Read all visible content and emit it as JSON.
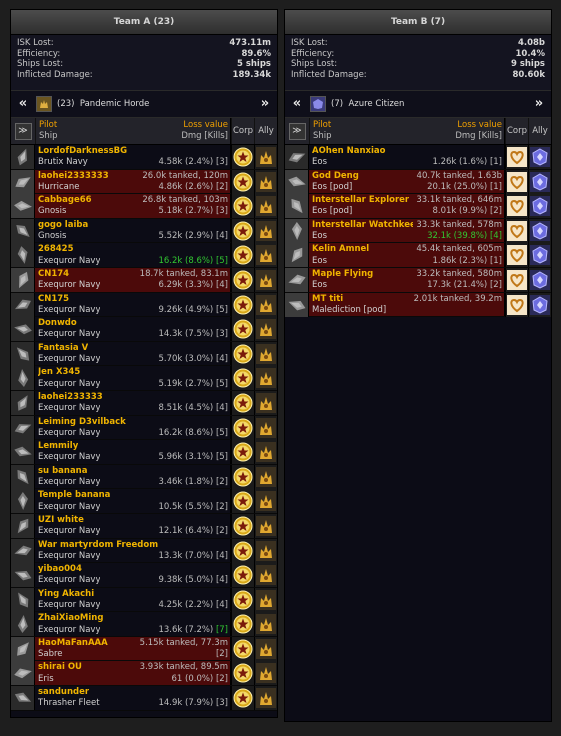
{
  "teams": [
    {
      "title": "Team A (23)",
      "stats": [
        {
          "label": "ISK Lost:",
          "value": "473.11m"
        },
        {
          "label": "Efficiency:",
          "value": "89.6%"
        },
        {
          "label": "Ships Lost:",
          "value": "5 ships"
        },
        {
          "label": "Inflicted Damage:",
          "value": "189.34k"
        }
      ],
      "alliance": {
        "count": "(23)",
        "name": "Pandemic Horde"
      },
      "header": {
        "pilot": "Pilot",
        "loss": "Loss value",
        "ship": "Ship",
        "dmg": "Dmg [Kills]",
        "corp": "Corp",
        "ally": "Ally",
        "expand": "≫"
      },
      "rows": [
        {
          "pilot": "LordofDarknessBG",
          "loss": "",
          "ship": "Brutix Navy",
          "dmg": "4.58k (2.4%) [3]",
          "lost": false
        },
        {
          "pilot": "laohei2333333",
          "loss": "26.0k tanked, 120m",
          "ship": "Hurricane",
          "dmg": "4.86k (2.6%) [2]",
          "lost": true
        },
        {
          "pilot": "Cabbage66",
          "loss": "26.8k tanked, 103m",
          "ship": "Gnosis",
          "dmg": "5.18k (2.7%) [3]",
          "lost": true
        },
        {
          "pilot": "gogo laiba",
          "loss": "",
          "ship": "Gnosis",
          "dmg": "5.52k (2.9%) [4]",
          "lost": false
        },
        {
          "pilot": "268425",
          "loss": "",
          "ship": "Exequror Navy",
          "dmg": "16.2k (8.6%) [5]",
          "lost": false,
          "green": true
        },
        {
          "pilot": "CN174",
          "loss": "18.7k tanked, 83.1m",
          "ship": "Exequror Navy",
          "dmg": "6.29k (3.3%) [4]",
          "lost": true
        },
        {
          "pilot": "CN175",
          "loss": "",
          "ship": "Exequror Navy",
          "dmg": "9.26k (4.9%) [5]",
          "lost": false
        },
        {
          "pilot": "Donwdo",
          "loss": "",
          "ship": "Exequror Navy",
          "dmg": "14.3k (7.5%) [3]",
          "lost": false
        },
        {
          "pilot": "Fantasia V",
          "loss": "",
          "ship": "Exequror Navy",
          "dmg": "5.70k (3.0%) [4]",
          "lost": false
        },
        {
          "pilot": "Jen X345",
          "loss": "",
          "ship": "Exequror Navy",
          "dmg": "5.19k (2.7%) [5]",
          "lost": false
        },
        {
          "pilot": "laohei233333",
          "loss": "",
          "ship": "Exequror Navy",
          "dmg": "8.51k (4.5%) [4]",
          "lost": false
        },
        {
          "pilot": "Leiming D3vilback",
          "loss": "",
          "ship": "Exequror Navy",
          "dmg": "16.2k (8.6%) [5]",
          "lost": false
        },
        {
          "pilot": "Lemmily",
          "loss": "",
          "ship": "Exequror Navy",
          "dmg": "5.96k (3.1%) [5]",
          "lost": false
        },
        {
          "pilot": "su banana",
          "loss": "",
          "ship": "Exequror Navy",
          "dmg": "3.46k (1.8%) [2]",
          "lost": false
        },
        {
          "pilot": "Temple banana",
          "loss": "",
          "ship": "Exequror Navy",
          "dmg": "10.5k (5.5%) [2]",
          "lost": false
        },
        {
          "pilot": "UZI white",
          "loss": "",
          "ship": "Exequror Navy",
          "dmg": "12.1k (6.4%) [2]",
          "lost": false
        },
        {
          "pilot": "War martyrdom Freedom",
          "loss": "",
          "ship": "Exequror Navy",
          "dmg": "13.3k (7.0%) [4]",
          "lost": false
        },
        {
          "pilot": "yibao004",
          "loss": "",
          "ship": "Exequror Navy",
          "dmg": "9.38k (5.0%) [4]",
          "lost": false
        },
        {
          "pilot": "Ying Akachi",
          "loss": "",
          "ship": "Exequror Navy",
          "dmg": "4.25k (2.2%) [4]",
          "lost": false
        },
        {
          "pilot": "ZhaiXiaoMing",
          "loss": "",
          "ship": "Exequror Navy",
          "dmg": "13.6k (7.2%) ",
          "kills": "[7]",
          "lost": false
        },
        {
          "pilot": "HaoMaFanAAA",
          "loss": "5.15k tanked, 77.3m",
          "ship": "Sabre",
          "dmg": "[2]",
          "lost": true
        },
        {
          "pilot": "shirai OU",
          "loss": "3.93k tanked, 89.5m",
          "ship": "Eris",
          "dmg": "61 (0.0%) [2]",
          "lost": true
        },
        {
          "pilot": "sandunder",
          "loss": "",
          "ship": "Thrasher Fleet",
          "dmg": "14.9k (7.9%) [3]",
          "lost": false
        }
      ]
    },
    {
      "title": "Team B (7)",
      "stats": [
        {
          "label": "ISK Lost:",
          "value": "4.08b"
        },
        {
          "label": "Efficiency:",
          "value": "10.4%"
        },
        {
          "label": "Ships Lost:",
          "value": "9 ships"
        },
        {
          "label": "Inflicted Damage:",
          "value": "80.60k"
        }
      ],
      "alliance": {
        "count": "(7)",
        "name": "Azure Citizen"
      },
      "header": {
        "pilot": "Pilot",
        "loss": "Loss value",
        "ship": "Ship",
        "dmg": "Dmg [Kills]",
        "corp": "Corp",
        "ally": "Ally",
        "expand": "≫"
      },
      "rows": [
        {
          "pilot": "AOhen Nanxiao",
          "loss": "",
          "ship": "Eos",
          "dmg": "1.26k (1.6%) [1]",
          "lost": false
        },
        {
          "pilot": "God Deng",
          "loss": "40.7k tanked, 1.63b",
          "ship": "Eos [pod]",
          "dmg": "20.1k (25.0%) [1]",
          "lost": true
        },
        {
          "pilot": "Interstellar Explorer",
          "loss": "33.1k tanked, 646m",
          "ship": "Eos [pod]",
          "dmg": "8.01k (9.9%) [2]",
          "lost": true
        },
        {
          "pilot": "Interstellar Watchkeeper",
          "loss": "33.3k tanked, 578m",
          "ship": "Eos",
          "dmg": "32.1k (39.8%) [4]",
          "lost": true,
          "green": true
        },
        {
          "pilot": "Kelin Amnel",
          "loss": "45.4k tanked, 605m",
          "ship": "Eos",
          "dmg": "1.86k (2.3%) [1]",
          "lost": true
        },
        {
          "pilot": "Maple Flying",
          "loss": "33.2k tanked, 580m",
          "ship": "Eos",
          "dmg": "17.3k (21.4%) [2]",
          "lost": true
        },
        {
          "pilot": "MT titi",
          "loss": "2.01k tanked, 39.2m",
          "ship": "Malediction [pod]",
          "dmg": "",
          "lost": true
        }
      ]
    }
  ],
  "colors": {
    "accent": "#f0b400",
    "lost_row": "#4c0a0a",
    "green": "#32c832"
  },
  "icons": {
    "nav_prev": "chevron-double-left-icon",
    "nav_next": "chevron-double-right-icon",
    "corp_a": "star-medal-icon",
    "ally_a": "horde-logo-icon",
    "corp_b": "heart-logo-icon",
    "ally_b": "azure-citizen-logo-icon"
  }
}
